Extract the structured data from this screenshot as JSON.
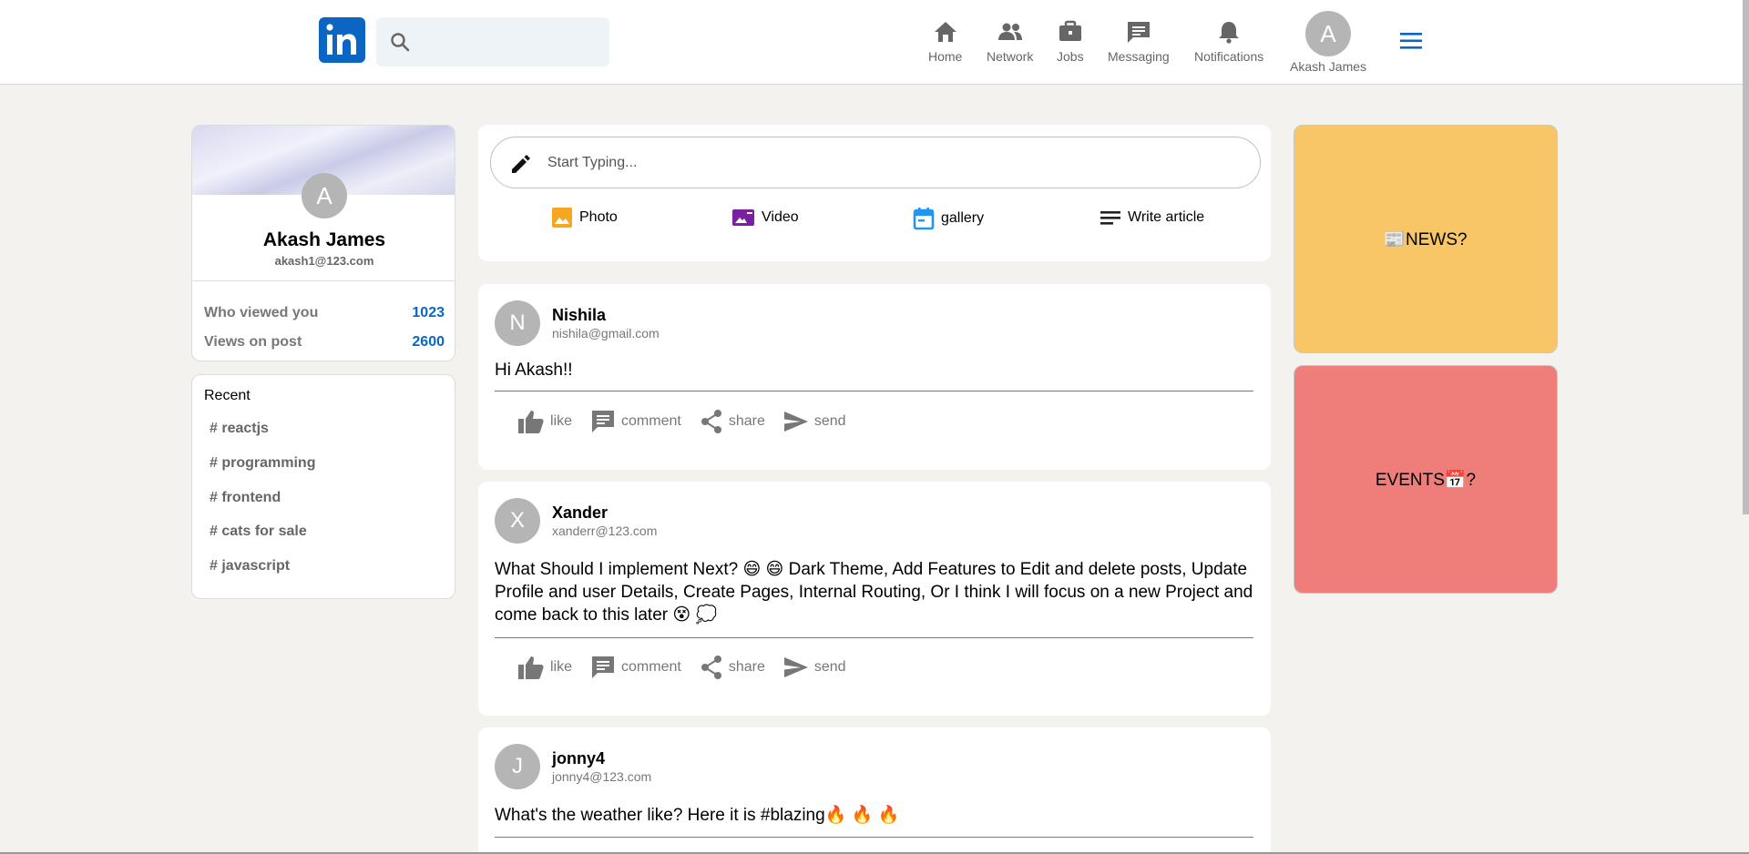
{
  "header": {
    "logo_text": "in",
    "search_placeholder": "",
    "nav": [
      {
        "label": "Home",
        "icon": "home-icon"
      },
      {
        "label": "Network",
        "icon": "network-icon"
      },
      {
        "label": "Jobs",
        "icon": "briefcase-icon"
      },
      {
        "label": "Messaging",
        "icon": "message-icon"
      },
      {
        "label": "Notifications",
        "icon": "bell-icon"
      }
    ],
    "me": {
      "initial": "A",
      "label": "Akash James"
    },
    "menu_icon": "hamburger-icon"
  },
  "sidebar": {
    "profile": {
      "initial": "A",
      "name": "Akash James",
      "email": "akash1@123.com",
      "stats": [
        {
          "label": "Who viewed you",
          "value": "1023"
        },
        {
          "label": "Views on post",
          "value": "2600"
        }
      ]
    },
    "recent": {
      "title": "Recent",
      "tags": [
        "# reactjs",
        "# programming",
        "# frontend",
        "# cats for sale",
        "# javascript"
      ]
    }
  },
  "composer": {
    "placeholder": "Start Typing...",
    "options": [
      {
        "label": "Photo",
        "icon": "photo-icon",
        "color": "#f5a623"
      },
      {
        "label": "Video",
        "icon": "video-icon",
        "color": "#7b1fa2"
      },
      {
        "label": "gallery",
        "icon": "calendar-icon",
        "color": "#2196f3"
      },
      {
        "label": "Write article",
        "icon": "article-icon",
        "color": "#222222"
      }
    ]
  },
  "posts": [
    {
      "initial": "N",
      "author": "Nishila",
      "email": "nishila@gmail.com",
      "text": "Hi Akash!!"
    },
    {
      "initial": "X",
      "author": "Xander",
      "email": "xanderr@123.com",
      "text": "What Should I implement Next? 😄 😄 Dark Theme, Add Features to Edit and delete posts, Update Profile and user Details, Create Pages, Internal Routing, Or I think I will focus on a new Project and come back to this later 😵 💭"
    },
    {
      "initial": "J",
      "author": "jonny4",
      "email": "jonny4@123.com",
      "text": "What's the weather like? Here it is #blazing🔥 🔥 🔥"
    }
  ],
  "actions": [
    "like",
    "comment",
    "share",
    "send"
  ],
  "widgets": {
    "news": "📰NEWS?",
    "events": "EVENTS📅?"
  },
  "colors": {
    "brand": "#0a66c2",
    "news_bg": "#f9c667",
    "events_bg": "#ef7e7a",
    "page_bg": "#f3f2ef"
  }
}
